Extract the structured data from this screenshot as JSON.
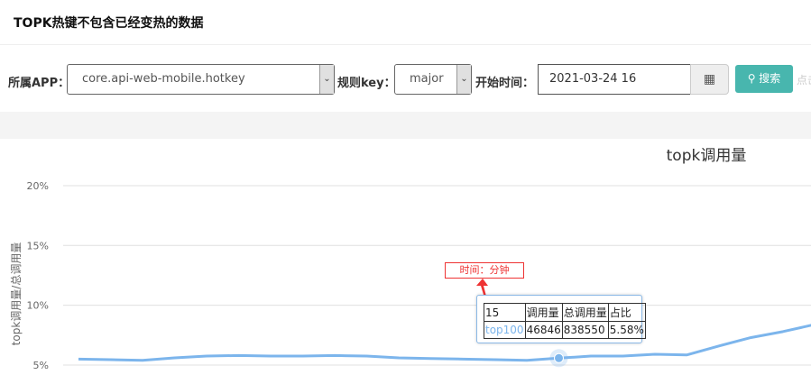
{
  "header": {
    "title": "TOPK热键不包含已经变热的数据"
  },
  "form": {
    "app_label": "所属APP：",
    "app_value": "core.api-web-mobile.hotkey",
    "rule_label": "规则key：",
    "rule_value": "major",
    "time_label": "开始时间：",
    "time_value": "2021-03-24 16",
    "search_label": "搜索",
    "hint": "点击"
  },
  "chart_data": {
    "type": "line",
    "title": "topk调用量",
    "ylabel": "topk调用量/总调用量",
    "xlabel": "",
    "ylim": [
      4.5,
      20
    ],
    "yticks": [
      "5%",
      "10%",
      "15%",
      "20%"
    ],
    "ytick_values": [
      5,
      10,
      15,
      20
    ],
    "grid": true,
    "series": [
      {
        "x": [
          0,
          1,
          2,
          3,
          4,
          5,
          6,
          7,
          8,
          9,
          10,
          11,
          12,
          13,
          14,
          15,
          16,
          17,
          18,
          19,
          20,
          21,
          22,
          23
        ],
        "values": [
          5.5,
          5.45,
          5.4,
          5.6,
          5.75,
          5.8,
          5.75,
          5.75,
          5.8,
          5.75,
          5.6,
          5.55,
          5.5,
          5.45,
          5.4,
          5.58,
          5.75,
          5.75,
          5.9,
          5.85,
          6.6,
          7.3,
          7.8,
          8.4
        ],
        "color": "#7cb5ec"
      }
    ]
  },
  "tooltip": {
    "x": "15",
    "headers": [
      "调用量",
      "总调用量",
      "占比"
    ],
    "series": "top100",
    "values": [
      "46846",
      "838550",
      "5.58%"
    ]
  },
  "annotation": {
    "text": "时间：分钟"
  }
}
